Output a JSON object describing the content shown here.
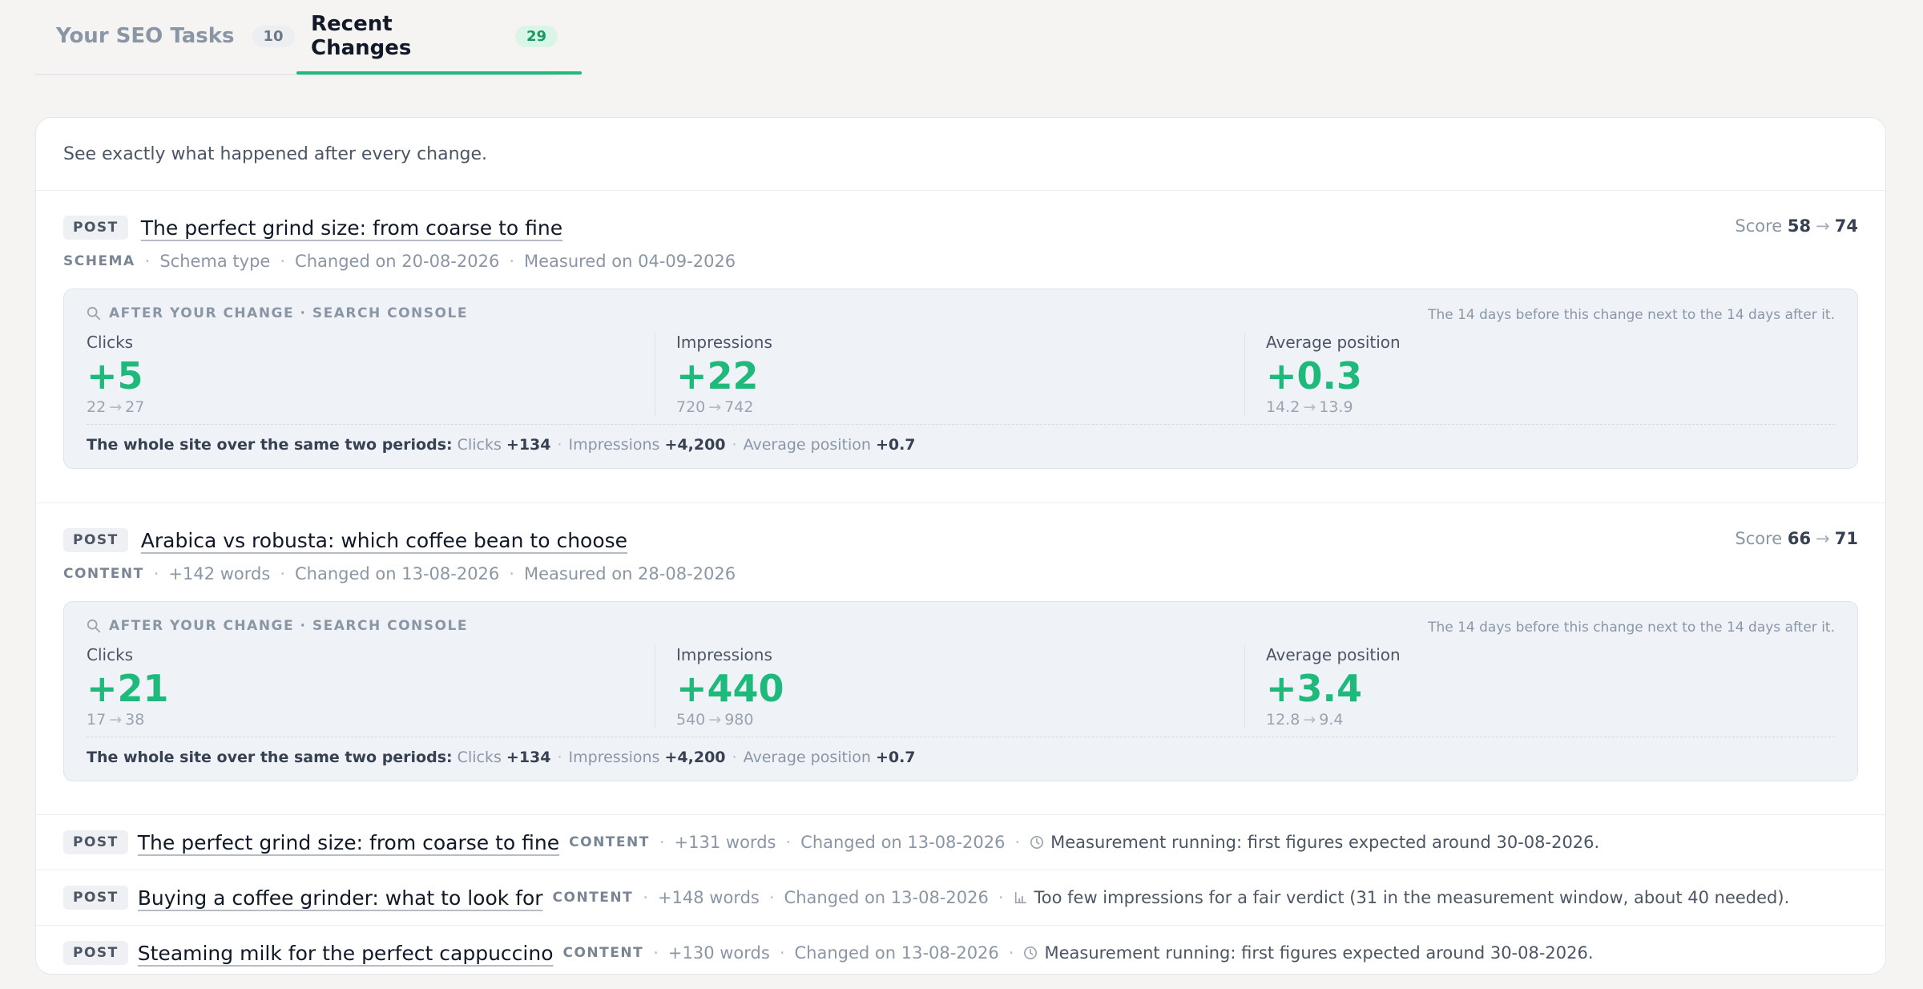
{
  "tabs": [
    {
      "label": "Your SEO Tasks",
      "count": "10"
    },
    {
      "label": "Recent Changes",
      "count": "29"
    }
  ],
  "intro": "See exactly what happened after every change.",
  "detailed": [
    {
      "tag": "POST",
      "title": "The perfect grind size: from coarse to fine",
      "score_label": "Score",
      "score_from": "58",
      "score_to": "74",
      "type": "SCHEMA",
      "detail": "Schema type",
      "changed": "Changed on 20-08-2026",
      "measured": "Measured on 04-09-2026",
      "panel_heading": "AFTER YOUR CHANGE · SEARCH CONSOLE",
      "panel_note": "The 14 days before this change next to the 14 days after it.",
      "metrics": [
        {
          "label": "Clicks",
          "value": "+5",
          "from": "22",
          "to": "27"
        },
        {
          "label": "Impressions",
          "value": "+22",
          "from": "720",
          "to": "742"
        },
        {
          "label": "Average position",
          "value": "+0.3",
          "from": "14.2",
          "to": "13.9"
        }
      ],
      "site": {
        "lead": "The whole site over the same two periods:",
        "clicks_label": "Clicks",
        "clicks": "+134",
        "impressions_label": "Impressions",
        "impressions": "+4,200",
        "position_label": "Average position",
        "position": "+0.7"
      }
    },
    {
      "tag": "POST",
      "title": "Arabica vs robusta: which coffee bean to choose",
      "score_label": "Score",
      "score_from": "66",
      "score_to": "71",
      "type": "CONTENT",
      "detail": "+142 words",
      "changed": "Changed on 13-08-2026",
      "measured": "Measured on 28-08-2026",
      "panel_heading": "AFTER YOUR CHANGE · SEARCH CONSOLE",
      "panel_note": "The 14 days before this change next to the 14 days after it.",
      "metrics": [
        {
          "label": "Clicks",
          "value": "+21",
          "from": "17",
          "to": "38"
        },
        {
          "label": "Impressions",
          "value": "+440",
          "from": "540",
          "to": "980"
        },
        {
          "label": "Average position",
          "value": "+3.4",
          "from": "12.8",
          "to": "9.4"
        }
      ],
      "site": {
        "lead": "The whole site over the same two periods:",
        "clicks_label": "Clicks",
        "clicks": "+134",
        "impressions_label": "Impressions",
        "impressions": "+4,200",
        "position_label": "Average position",
        "position": "+0.7"
      }
    }
  ],
  "compact": [
    {
      "tag": "POST",
      "title": "The perfect grind size: from coarse to fine",
      "type": "CONTENT",
      "detail": "+131 words",
      "changed": "Changed on 13-08-2026",
      "status_icon": "clock-icon",
      "status": "Measurement running: first figures expected around 30-08-2026."
    },
    {
      "tag": "POST",
      "title": "Buying a coffee grinder: what to look for",
      "type": "CONTENT",
      "detail": "+148 words",
      "changed": "Changed on 13-08-2026",
      "status_icon": "bar-chart-icon",
      "status": "Too few impressions for a fair verdict (31 in the measurement window, about 40 needed)."
    },
    {
      "tag": "POST",
      "title": "Steaming milk for the perfect cappuccino",
      "type": "CONTENT",
      "detail": "+130 words",
      "changed": "Changed on 13-08-2026",
      "status_icon": "clock-icon",
      "status": "Measurement running: first figures expected around 30-08-2026."
    }
  ],
  "colors": {
    "accent": "#1fba7b",
    "panel_bg": "#eff3f8",
    "page_bg": "#f5f4f2"
  }
}
